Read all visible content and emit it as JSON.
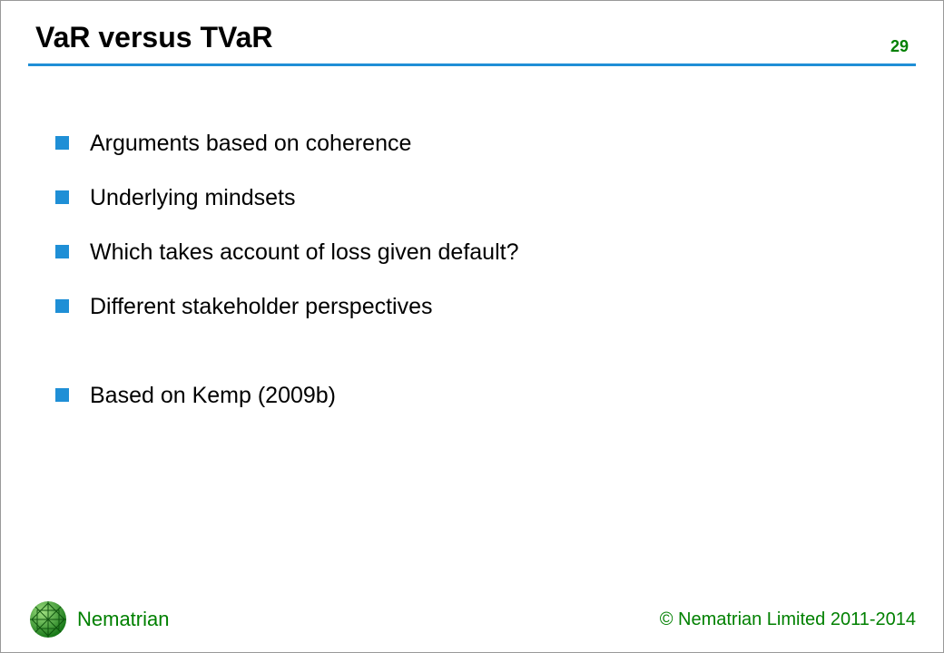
{
  "header": {
    "title": "VaR versus TVaR",
    "page_number": "29"
  },
  "bullets": [
    "Arguments based on coherence",
    "Underlying mindsets",
    "Which takes account of loss given default?",
    "Different stakeholder perspectives",
    "Based on Kemp (2009b)"
  ],
  "footer": {
    "brand": "Nematrian",
    "copyright": "© Nematrian Limited 2011-2014"
  },
  "colors": {
    "accent_blue": "#1f8fd6",
    "brand_green": "#008000"
  }
}
